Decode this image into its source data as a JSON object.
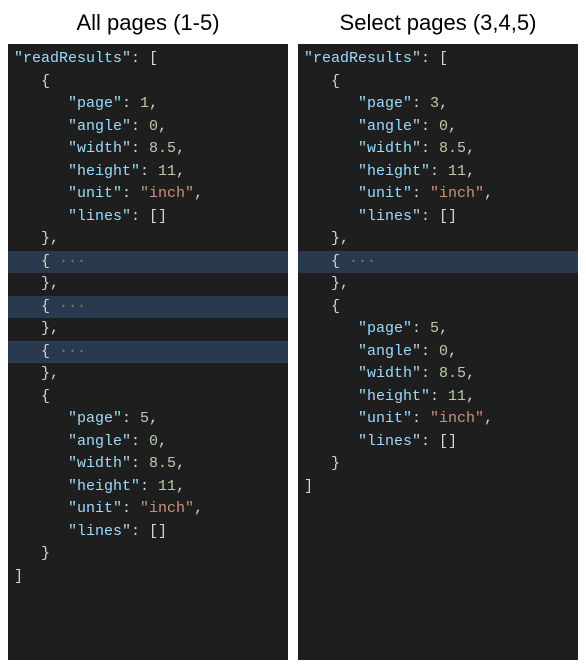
{
  "panels": [
    {
      "title": "All pages (1-5)",
      "root_key": "readResults",
      "entries": [
        {
          "type": "expanded",
          "props": {
            "page": 1,
            "angle": 0,
            "width": 8.5,
            "height": 11,
            "unit": "inch",
            "lines_label": "lines"
          },
          "trailing_comma": true
        },
        {
          "type": "folded",
          "trailing_comma": true
        },
        {
          "type": "folded",
          "trailing_comma": true
        },
        {
          "type": "folded",
          "trailing_comma": true
        },
        {
          "type": "expanded",
          "props": {
            "page": 5,
            "angle": 0,
            "width": 8.5,
            "height": 11,
            "unit": "inch",
            "lines_label": "lines"
          },
          "trailing_comma": false
        }
      ]
    },
    {
      "title": "Select pages (3,4,5)",
      "root_key": "readResults",
      "entries": [
        {
          "type": "expanded",
          "props": {
            "page": 3,
            "angle": 0,
            "width": 8.5,
            "height": 11,
            "unit": "inch",
            "lines_label": "lines"
          },
          "trailing_comma": true
        },
        {
          "type": "folded",
          "trailing_comma": true
        },
        {
          "type": "expanded",
          "props": {
            "page": 5,
            "angle": 0,
            "width": 8.5,
            "height": 11,
            "unit": "inch",
            "lines_label": "lines"
          },
          "trailing_comma": false
        }
      ]
    }
  ],
  "labels": {
    "page": "page",
    "angle": "angle",
    "width": "width",
    "height": "height",
    "unit": "unit",
    "lines": "lines",
    "ellipsis": "···"
  }
}
